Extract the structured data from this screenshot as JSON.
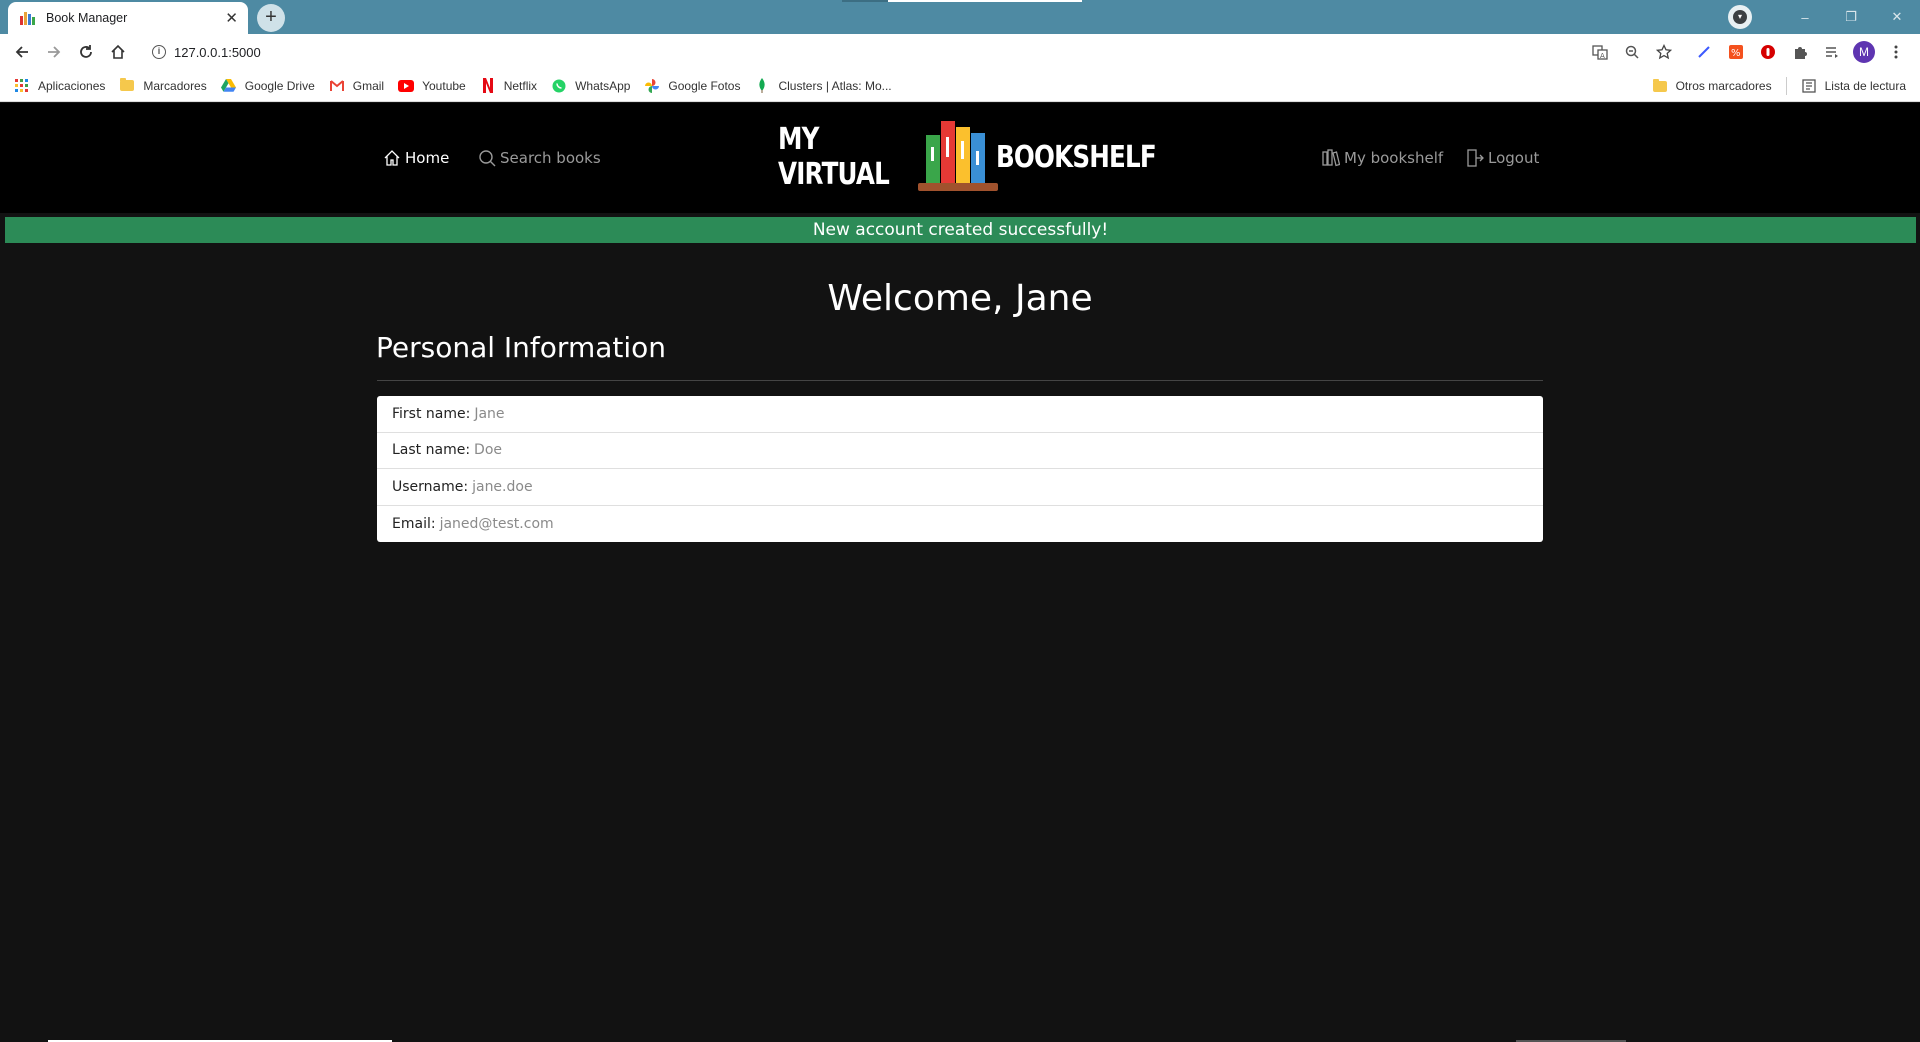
{
  "browser": {
    "tab_title": "Book Manager",
    "tab_close": "✕",
    "new_tab": "+",
    "url": "127.0.0.1:5000",
    "profile_initial": "M",
    "window_controls": [
      "–",
      "❐",
      "✕"
    ]
  },
  "bookmarks": {
    "items": [
      {
        "label": "Aplicaciones",
        "icon": "apps-grid-icon"
      },
      {
        "label": "Marcadores",
        "icon": "folder-icon"
      },
      {
        "label": "Google Drive",
        "icon": "google-drive-icon"
      },
      {
        "label": "Gmail",
        "icon": "gmail-icon"
      },
      {
        "label": "Youtube",
        "icon": "youtube-icon"
      },
      {
        "label": "Netflix",
        "icon": "netflix-icon"
      },
      {
        "label": "WhatsApp",
        "icon": "whatsapp-icon"
      },
      {
        "label": "Google Fotos",
        "icon": "google-photos-icon"
      },
      {
        "label": "Clusters | Atlas: Mo...",
        "icon": "mongodb-leaf-icon"
      }
    ],
    "other": "Otros marcadores",
    "reading_list": "Lista de lectura"
  },
  "header": {
    "home": "Home",
    "search": "Search books",
    "logo_left": "MY VIRTUAL",
    "logo_right": "BOOKSHELF",
    "my_bookshelf": "My bookshelf",
    "logout": "Logout"
  },
  "alert": {
    "message": "New account created successfully!",
    "color": "#2c8b57"
  },
  "main": {
    "welcome": "Welcome, Jane",
    "section_title": "Personal Information",
    "fields": [
      {
        "label": "First name:",
        "value": "Jane"
      },
      {
        "label": "Last name:",
        "value": "Doe"
      },
      {
        "label": "Username:",
        "value": "jane.doe"
      },
      {
        "label": "Email:",
        "value": "janed@test.com"
      }
    ]
  },
  "colors": {
    "tabbar": "#4e8aa3",
    "header_bg": "#000000",
    "page_bg": "#121212",
    "nav_active": "#ffffff",
    "nav_inactive": "#9a9a9a"
  }
}
